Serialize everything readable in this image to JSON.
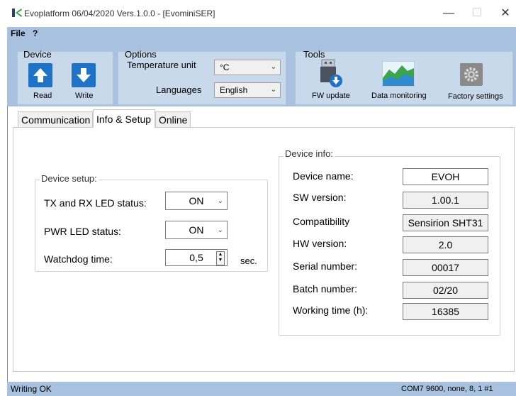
{
  "window": {
    "title": "Evoplatform 06/04/2020 Vers.1.0.0 - [EvominiSER]",
    "minimize_glyph": "—",
    "maximize_glyph": "☐",
    "close_glyph": "✕"
  },
  "menu": {
    "file": "File",
    "help": "?"
  },
  "ribbon": {
    "device": {
      "title": "Device",
      "read_label": "Read",
      "write_label": "Write"
    },
    "options": {
      "title": "Options",
      "temperature_label": "Temperature unit",
      "temperature_value": "°C",
      "languages_label": "Languages",
      "languages_value": "English"
    },
    "tools": {
      "title": "Tools",
      "fw_update_label": "FW update",
      "data_monitoring_label": "Data monitoring",
      "factory_settings_label": "Factory settings"
    }
  },
  "tabs": [
    {
      "label": "Communication",
      "active": false
    },
    {
      "label": "Info & Setup",
      "active": true
    },
    {
      "label": "Online",
      "active": false
    }
  ],
  "device_setup": {
    "legend": "Device setup:",
    "tx_rx_led_label": "TX and RX LED status:",
    "tx_rx_led_value": "ON",
    "pwr_led_label": "PWR LED status:",
    "pwr_led_value": "ON",
    "watchdog_label": "Watchdog time:",
    "watchdog_value": "0,5",
    "watchdog_unit": "sec."
  },
  "device_info": {
    "legend": "Device info:",
    "rows": [
      {
        "label": "Device name:",
        "value": "EVOH"
      },
      {
        "label": "SW version:",
        "value": "1.00.1"
      },
      {
        "label": "Compatibility",
        "value": "Sensirion SHT31"
      },
      {
        "label": "HW version:",
        "value": "2.0"
      },
      {
        "label": "Serial number:",
        "value": "00017"
      },
      {
        "label": "Batch number:",
        "value": "02/20"
      },
      {
        "label": "Working time (h):",
        "value": "16385"
      }
    ]
  },
  "status": {
    "left": "Writing OK",
    "right": "COM7 9600, none, 8, 1 #1"
  },
  "colors": {
    "ribbon": "#a8c1de",
    "group": "#c9d9ec",
    "button_blue": "#1f73c7"
  }
}
